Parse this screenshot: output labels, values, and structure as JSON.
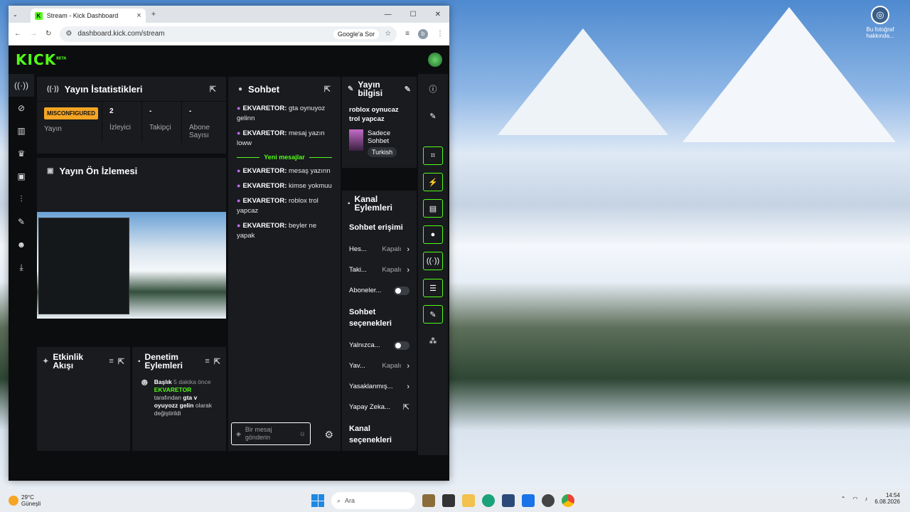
{
  "browser": {
    "tab_title": "Stream - Kick Dashboard",
    "url": "dashboard.kick.com/stream",
    "google_button": "Google'a Sor",
    "profile_initial": "b"
  },
  "desktop": {
    "icon_label": "Bu fotoğraf hakkında..."
  },
  "kick": {
    "logo": "KICK",
    "logo_sup": "BETA",
    "stats": {
      "title": "Yayın İstatistikleri",
      "badge": "MISCONFIGURED",
      "status_label": "Yayın",
      "viewers_value": "2",
      "viewers_label": "İzleyici",
      "followers_value": "-",
      "followers_label": "Takipçi",
      "subs_value": "-",
      "subs_label": "Abone Sayısı"
    },
    "preview": {
      "title": "Yayın Ön İzlemesi"
    },
    "chat": {
      "title": "Sohbet",
      "messages_before": [
        {
          "user": "EKVARETOR:",
          "text": "gta oynuyoz gelinn"
        },
        {
          "user": "EKVARETOR:",
          "text": "mesaj yazın loww"
        }
      ],
      "new_messages": "Yeni mesajlar",
      "messages_after": [
        {
          "user": "EKVARETOR:",
          "text": "mesaş yazınn"
        },
        {
          "user": "EKVARETOR:",
          "text": "kimse yokmuu"
        },
        {
          "user": "EKVARETOR:",
          "text": "roblox trol yapcaz"
        },
        {
          "user": "EKVARETOR:",
          "text": "beyler ne yapak"
        }
      ],
      "input_placeholder": "Bir mesaj gönderin"
    },
    "info": {
      "title": "Yayın bilgisi",
      "stream_title": "roblox oynucaz trol yapcaz",
      "category": "Sadece Sohbet",
      "language_tag": "Turkish"
    },
    "channel_actions": {
      "title": "Kanal Eylemleri",
      "chat_access": "Sohbet erişimi",
      "rows1": [
        {
          "label": "Hes...",
          "value": "Kapalı"
        },
        {
          "label": "Taki...",
          "value": "Kapalı"
        }
      ],
      "subscribers": "Aboneler...",
      "chat_options": "Sohbet seçenekleri",
      "only": "Yalnızca...",
      "slow": "Yav...",
      "slow_value": "Kapalı",
      "banned": "Yasaklanmış...",
      "ai": "Yapay Zeka...",
      "channel_options": "Kanal seçenekleri"
    },
    "activity": {
      "title": "Etkinlik Akışı"
    },
    "audit": {
      "title": "Denetim Eylemleri",
      "item_label": "Başlık",
      "item_time": "5 dakika önce",
      "item_user": "EKVARETOR",
      "item_by": "tarafından",
      "item_value": "gta v oyuyozz gelin",
      "item_suffix": "olarak değiştirildi"
    }
  },
  "taskbar": {
    "temp": "29°C",
    "weather": "Güneşli",
    "search_placeholder": "Ara",
    "time": "14:54",
    "date": "6.08.2026"
  }
}
